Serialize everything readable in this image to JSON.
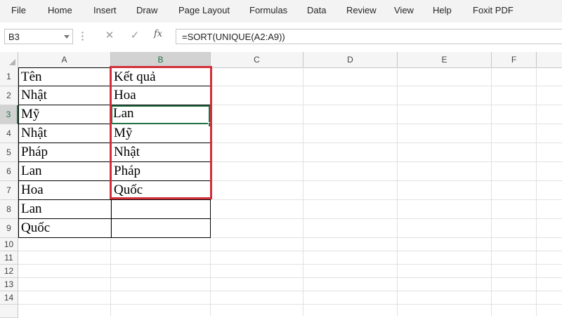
{
  "menu": {
    "items": [
      "File",
      "Home",
      "Insert",
      "Draw",
      "Page Layout",
      "Formulas",
      "Data",
      "Review",
      "View",
      "Help",
      "Foxit PDF"
    ]
  },
  "formula_bar": {
    "name_box": "B3",
    "cancel_icon": "✕",
    "enter_icon": "✓",
    "fx_label": "fx",
    "formula": "=SORT(UNIQUE(A2:A9))"
  },
  "columns": [
    "A",
    "B",
    "C",
    "D",
    "E",
    "F"
  ],
  "rows": [
    "1",
    "2",
    "3",
    "4",
    "5",
    "6",
    "7",
    "8",
    "9",
    "10",
    "11",
    "12",
    "13",
    "14"
  ],
  "column_a": [
    "Tên",
    "Nhật",
    "Mỹ",
    "Nhật",
    "Pháp",
    "Lan",
    "Hoa",
    "Lan",
    "Quốc"
  ],
  "column_b": [
    "Kết quả",
    "Hoa",
    "Lan",
    "Mỹ",
    "Nhật",
    "Pháp",
    "Quốc",
    "",
    ""
  ],
  "colors": {
    "accent": "#217346",
    "highlight": "#d32f3a"
  }
}
